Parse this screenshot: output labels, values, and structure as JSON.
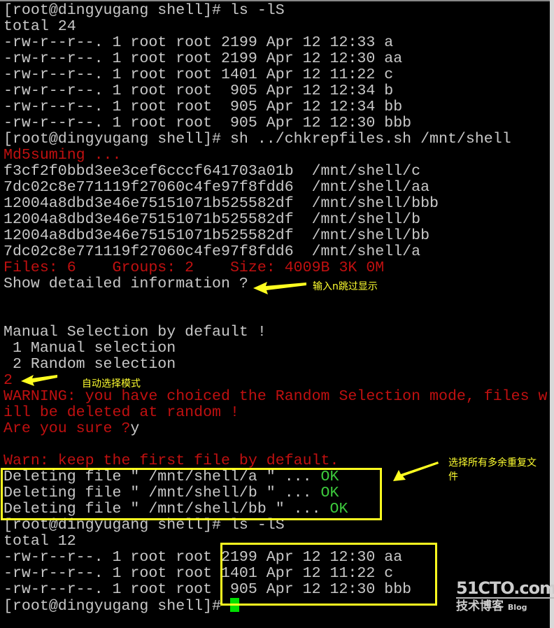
{
  "terminal": {
    "lines": [
      [
        {
          "t": "[root@dingyugang shell]# ls -lS",
          "c": ""
        }
      ],
      [
        {
          "t": "total 24",
          "c": ""
        }
      ],
      [
        {
          "t": "-rw-r--r--. 1 root root 2199 Apr 12 12:33 a",
          "c": ""
        }
      ],
      [
        {
          "t": "-rw-r--r--. 1 root root 2199 Apr 12 12:30 aa",
          "c": ""
        }
      ],
      [
        {
          "t": "-rw-r--r--. 1 root root 1401 Apr 12 11:22 c",
          "c": ""
        }
      ],
      [
        {
          "t": "-rw-r--r--. 1 root root  905 Apr 12 12:34 b",
          "c": ""
        }
      ],
      [
        {
          "t": "-rw-r--r--. 1 root root  905 Apr 12 12:34 bb",
          "c": ""
        }
      ],
      [
        {
          "t": "-rw-r--r--. 1 root root  905 Apr 12 12:30 bbb",
          "c": ""
        }
      ],
      [
        {
          "t": "[root@dingyugang shell]# sh ../chkrepfiles.sh /mnt/shell",
          "c": ""
        }
      ],
      [
        {
          "t": "Md5suming ...",
          "c": "red"
        }
      ],
      [
        {
          "t": "f3cf2f0bbd3ee3cef6cccf641703a01b  /mnt/shell/c",
          "c": ""
        }
      ],
      [
        {
          "t": "7dc02c8e771119f27060c4fe97f8fdd6  /mnt/shell/aa",
          "c": ""
        }
      ],
      [
        {
          "t": "12004a8dbd3e46e75151071b525582df  /mnt/shell/bbb",
          "c": ""
        }
      ],
      [
        {
          "t": "12004a8dbd3e46e75151071b525582df  /mnt/shell/b",
          "c": ""
        }
      ],
      [
        {
          "t": "12004a8dbd3e46e75151071b525582df  /mnt/shell/bb",
          "c": ""
        }
      ],
      [
        {
          "t": "7dc02c8e771119f27060c4fe97f8fdd6  /mnt/shell/a",
          "c": ""
        }
      ],
      [
        {
          "t": "Files: 6    Groups: 2    Size: 4009B 3K 0M",
          "c": "red"
        }
      ],
      [
        {
          "t": "Show detailed information ? ",
          "c": ""
        }
      ],
      [],
      [],
      [
        {
          "t": "Manual Selection by default !",
          "c": ""
        }
      ],
      [
        {
          "t": " 1 Manual selection",
          "c": ""
        }
      ],
      [
        {
          "t": " 2 Random selection",
          "c": ""
        }
      ],
      [
        {
          "t": "2",
          "c": "red"
        }
      ],
      [
        {
          "t": "WARNING: you have choiced the Random Selection mode, files w",
          "c": "red"
        }
      ],
      [
        {
          "t": "ill be deleted at random !",
          "c": "red"
        }
      ],
      [
        {
          "t": "Are you sure ?",
          "c": "red"
        },
        {
          "t": "y",
          "c": ""
        }
      ],
      [],
      [
        {
          "t": "Warn: keep the first file by default.",
          "c": "red"
        }
      ],
      [
        {
          "t": "Deleting file \" /mnt/shell/a \" ... ",
          "c": ""
        },
        {
          "t": "OK",
          "c": "green"
        }
      ],
      [
        {
          "t": "Deleting file \" /mnt/shell/b \" ... ",
          "c": ""
        },
        {
          "t": "OK",
          "c": "green"
        }
      ],
      [
        {
          "t": "Deleting file \" /mnt/shell/bb \" ... ",
          "c": ""
        },
        {
          "t": "OK",
          "c": "green"
        }
      ],
      [
        {
          "t": "[root@dingyugang shell]# ls -lS",
          "c": ""
        }
      ],
      [
        {
          "t": "total 12",
          "c": ""
        }
      ],
      [
        {
          "t": "-rw-r--r--. 1 root root 2199 Apr 12 12:30 aa",
          "c": ""
        }
      ],
      [
        {
          "t": "-rw-r--r--. 1 root root 1401 Apr 12 11:22 c",
          "c": ""
        }
      ],
      [
        {
          "t": "-rw-r--r--. 1 root root  905 Apr 12 12:30 bbb",
          "c": ""
        }
      ],
      [
        {
          "t": "[root@dingyugang shell]# ",
          "c": ""
        }
      ]
    ]
  },
  "annotations": {
    "skip_display": "输入n跳过显示",
    "auto_mode": "自动选择模式",
    "select_all_line1": "选择所有多余重复文",
    "select_all_line2": "件"
  },
  "watermark": {
    "brand": "51CTO.com",
    "sub": "技术博客",
    "blog": "Blog"
  },
  "colors": {
    "text": "#c8c8c8",
    "red": "#c01010",
    "green": "#3cc83c",
    "annotation": "#ffff20",
    "cursor": "#00e000"
  }
}
